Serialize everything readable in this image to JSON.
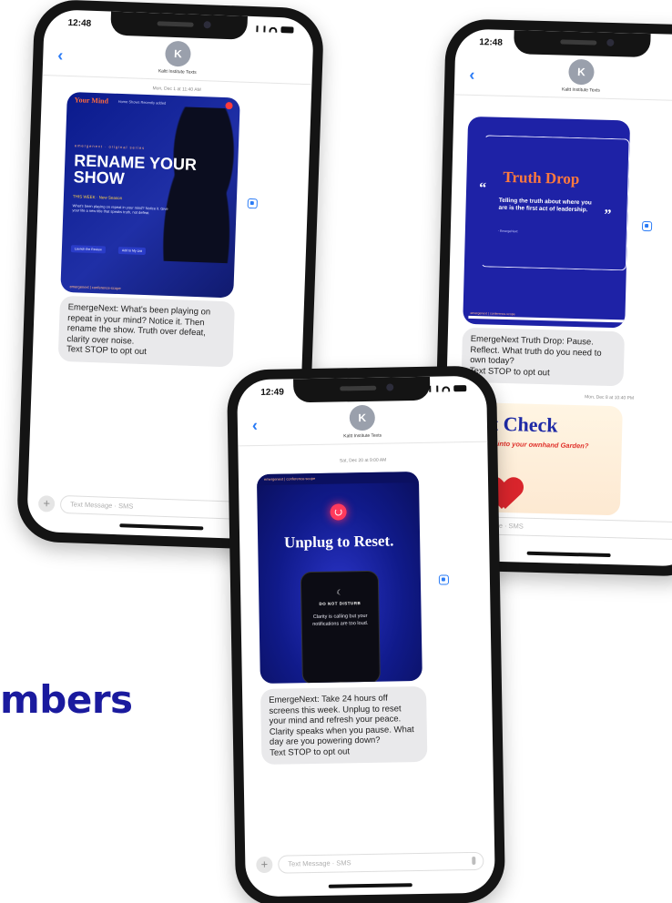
{
  "headline_fragment": "mbers",
  "phone_left": {
    "time": "12:48",
    "avatar_initial": "K",
    "contact": "Kaltt Institute Texts",
    "date_stamp": "Mon, Dec 1 at 11:40 AM",
    "graphic": {
      "brand": "Your Mind",
      "menu": "Home   Shows   Recently added",
      "series": "emergenext · original series",
      "headline": "RENAME YOUR SHOW",
      "subline": "THIS WEEK · New Season",
      "body": "What's been playing on repeat in your mind? Notice it. Give your life a new title that speaks truth, not defeat.",
      "btn1": "Launch the Review",
      "btn2": "Add to My List",
      "footer": "emergenext | conference-scope"
    },
    "message": "EmergeNext: What's been playing on repeat in your mind? Notice it. Then rename the show. Truth over defeat, clarity over noise.\nText STOP to opt out",
    "composer_placeholder": "Text Message · SMS"
  },
  "phone_right": {
    "time": "12:48",
    "avatar_initial": "K",
    "contact": "Kaltt Institute Texts",
    "graphic": {
      "title": "Truth Drop",
      "open_quote": "“",
      "close_quote": "”",
      "text": "Telling the truth about where you are is the first act of leadership.",
      "byline": "- EmergeNext",
      "footer": "emergenext | conference-scope"
    },
    "message": "EmergeNext Truth Drop: Pause. Reflect. What truth do you need to own today?\nText STOP to opt out",
    "date_stamp": "Mon, Dec 8 at 10:40 PM",
    "graphic2": {
      "title": "eart Check",
      "subtitle": "t's getting into your ownhand Garden?"
    },
    "composer_placeholder": "ext Message · SMS"
  },
  "phone_center": {
    "time": "12:49",
    "avatar_initial": "K",
    "contact": "Kaltt Institute Texts",
    "date_stamp": "Sat, Dec 20 at 9:00 AM",
    "graphic": {
      "topbar": "emergenext | conference-scope",
      "title": "Unplug to Reset.",
      "moon": "☾",
      "dnd": "DO NOT DISTURB",
      "device_text": "Clarity is calling but your notifications are too loud."
    },
    "message": "EmergeNext: Take 24 hours off screens this week. Unplug to reset your mind and refresh your peace. Clarity speaks when you pause. What day are you powering down?\nText STOP to opt out",
    "composer_placeholder": "Text Message · SMS"
  }
}
